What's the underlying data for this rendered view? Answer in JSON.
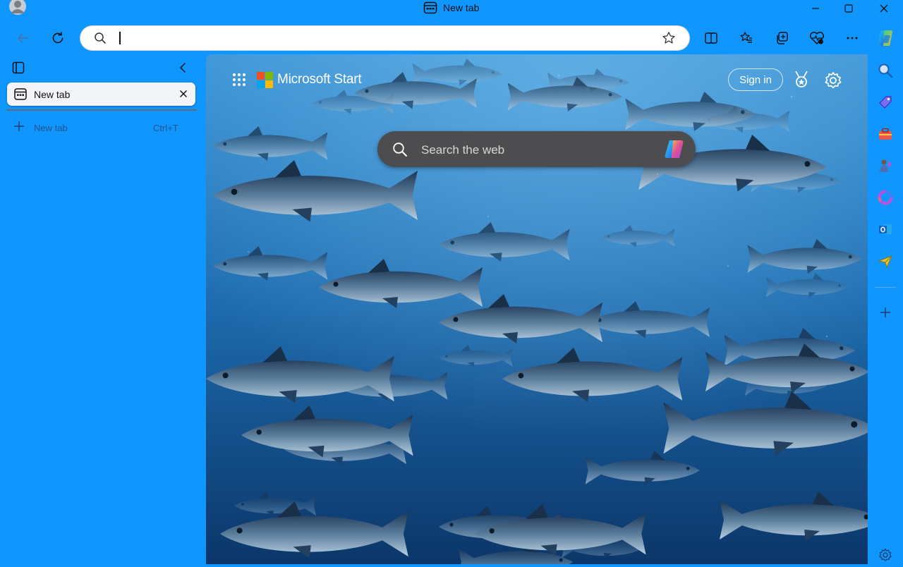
{
  "window": {
    "title": "New tab",
    "controls": [
      "minimize",
      "maximize",
      "close"
    ]
  },
  "toolbar": {
    "address_value": "",
    "icons": [
      "back-icon",
      "refresh-icon",
      "search-icon",
      "favorite-star-icon",
      "split-screen-icon",
      "favorites-icon",
      "collections-icon",
      "browser-essentials-icon",
      "more-icon",
      "copilot-icon"
    ]
  },
  "vertical_tabs": {
    "tabs": [
      {
        "label": "New tab",
        "active": true
      }
    ],
    "new_tab_label": "New tab",
    "new_tab_shortcut": "Ctrl+T"
  },
  "start_page": {
    "brand": "Microsoft Start",
    "sign_in_label": "Sign in",
    "search_placeholder": "Search the web",
    "background": "school of tuna underwater"
  },
  "sidebar": {
    "icons": [
      "search-icon",
      "shopping-tag-icon",
      "tools-icon",
      "games-icon",
      "microsoft365-icon",
      "outlook-icon",
      "drop-icon",
      "add-icon",
      "sidebar-settings-icon"
    ]
  },
  "colors": {
    "chrome": "#0f97ff",
    "address_bar": "#ffffff",
    "tab_card": "#f2f4f7",
    "search_box": "#4d4d4f",
    "ocean_top": "#2f86c9",
    "ocean_bottom": "#0d3b73"
  }
}
